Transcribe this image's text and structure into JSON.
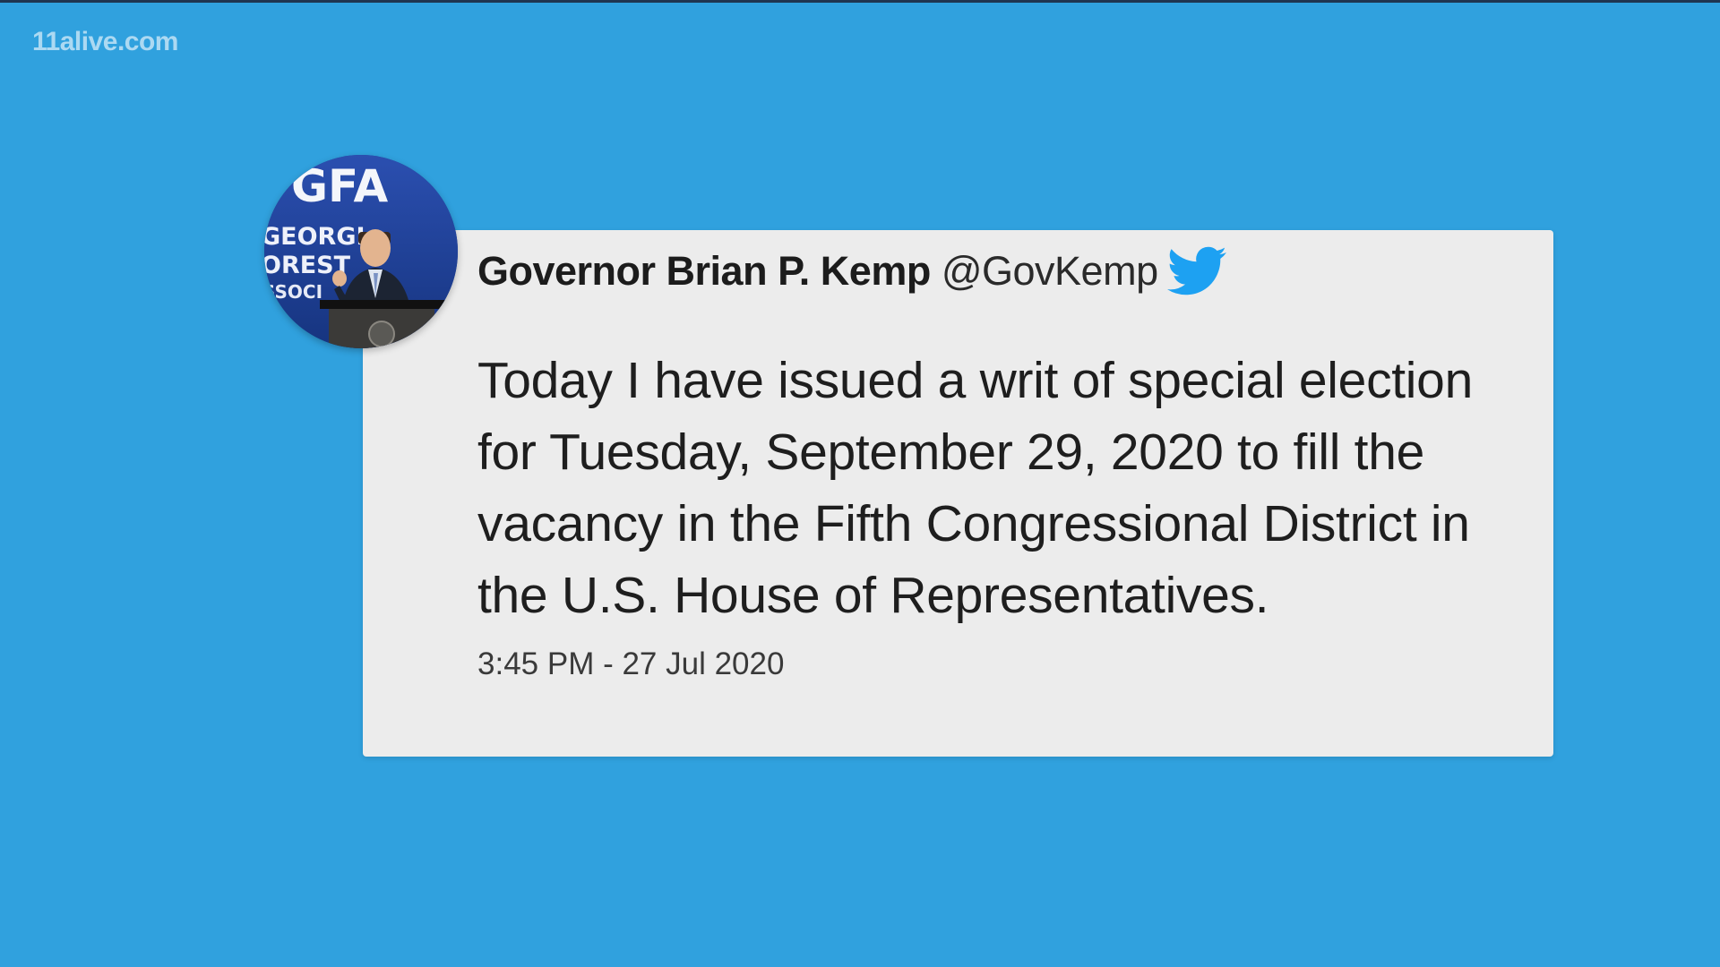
{
  "watermark": "11alive.com",
  "tweet": {
    "author_name": "Governor Brian P. Kemp",
    "author_handle": "@GovKemp",
    "text": "Today I have issued a writ of special election for Tuesday, September 29, 2020 to fill the vacancy in the Fifth Congressional District in the U.S. House of Representatives.",
    "timestamp": "3:45 PM - 27 Jul 2020"
  },
  "avatar": {
    "sign_text": "GFA",
    "banner_lines": [
      "GEORGI",
      "OREST",
      "SSOCI"
    ]
  },
  "colors": {
    "background": "#30a1de",
    "card": "#ececec",
    "twitter_blue": "#1da1f2"
  },
  "icons": {
    "brand": "twitter-bird-icon"
  }
}
